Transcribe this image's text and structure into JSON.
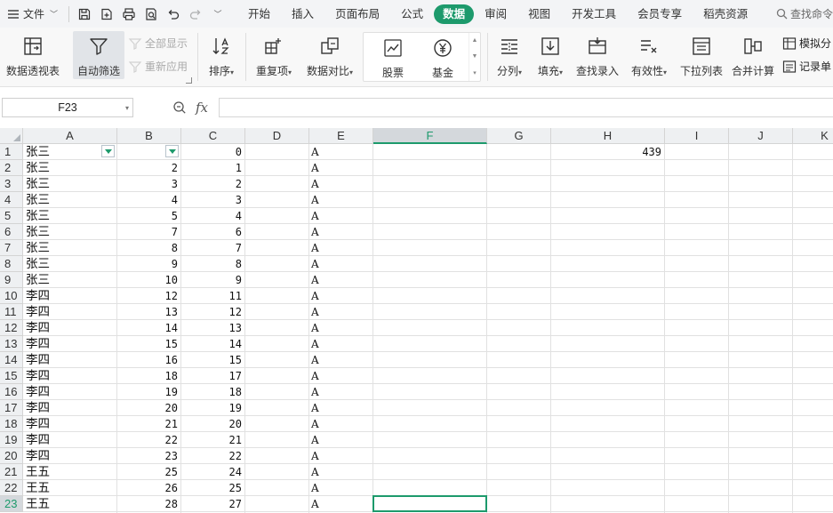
{
  "menubar": {
    "file_label": "文件",
    "tabs": [
      "开始",
      "插入",
      "页面布局",
      "公式",
      "数据",
      "审阅",
      "视图",
      "开发工具",
      "会员专享",
      "稻壳资源"
    ],
    "active_tab": "数据",
    "search_label": "查找命令",
    "accent_color": "#1d9a6c"
  },
  "ribbon": {
    "pivot_label": "数据透视表",
    "autofilter_label": "自动筛选",
    "show_all_label": "全部显示",
    "reapply_label": "重新应用",
    "sort_label": "排序",
    "duplicates_label": "重复项",
    "compare_label": "数据对比",
    "stock_label": "股票",
    "fund_label": "基金",
    "split_label": "分列",
    "fill_label": "填充",
    "lookup_label": "查找录入",
    "validity_label": "有效性",
    "dropdown_list_label": "下拉列表",
    "consolidate_label": "合并计算",
    "simulate_label": "模拟分",
    "record_label": "记录单"
  },
  "formula_bar": {
    "name_box": "F23",
    "fx_label": "fx",
    "formula": ""
  },
  "sheet": {
    "columns": [
      "A",
      "B",
      "C",
      "D",
      "E",
      "F",
      "G",
      "H",
      "I",
      "J",
      "K"
    ],
    "selected_column": "F",
    "selected_row": 23,
    "active_cell": "F23",
    "rows": [
      {
        "n": "1",
        "a": "张三",
        "b": "",
        "c": "0",
        "e": "A",
        "h": "439"
      },
      {
        "n": "2",
        "a": "张三",
        "b": "2",
        "c": "1",
        "e": "A",
        "h": ""
      },
      {
        "n": "3",
        "a": "张三",
        "b": "3",
        "c": "2",
        "e": "A",
        "h": ""
      },
      {
        "n": "4",
        "a": "张三",
        "b": "4",
        "c": "3",
        "e": "A",
        "h": ""
      },
      {
        "n": "5",
        "a": "张三",
        "b": "5",
        "c": "4",
        "e": "A",
        "h": ""
      },
      {
        "n": "6",
        "a": "张三",
        "b": "7",
        "c": "6",
        "e": "A",
        "h": ""
      },
      {
        "n": "7",
        "a": "张三",
        "b": "8",
        "c": "7",
        "e": "A",
        "h": ""
      },
      {
        "n": "8",
        "a": "张三",
        "b": "9",
        "c": "8",
        "e": "A",
        "h": ""
      },
      {
        "n": "9",
        "a": "张三",
        "b": "10",
        "c": "9",
        "e": "A",
        "h": ""
      },
      {
        "n": "10",
        "a": "李四",
        "b": "12",
        "c": "11",
        "e": "A",
        "h": ""
      },
      {
        "n": "11",
        "a": "李四",
        "b": "13",
        "c": "12",
        "e": "A",
        "h": ""
      },
      {
        "n": "12",
        "a": "李四",
        "b": "14",
        "c": "13",
        "e": "A",
        "h": ""
      },
      {
        "n": "13",
        "a": "李四",
        "b": "15",
        "c": "14",
        "e": "A",
        "h": ""
      },
      {
        "n": "14",
        "a": "李四",
        "b": "16",
        "c": "15",
        "e": "A",
        "h": ""
      },
      {
        "n": "15",
        "a": "李四",
        "b": "18",
        "c": "17",
        "e": "A",
        "h": ""
      },
      {
        "n": "16",
        "a": "李四",
        "b": "19",
        "c": "18",
        "e": "A",
        "h": ""
      },
      {
        "n": "17",
        "a": "李四",
        "b": "20",
        "c": "19",
        "e": "A",
        "h": ""
      },
      {
        "n": "18",
        "a": "李四",
        "b": "21",
        "c": "20",
        "e": "A",
        "h": ""
      },
      {
        "n": "19",
        "a": "李四",
        "b": "22",
        "c": "21",
        "e": "A",
        "h": ""
      },
      {
        "n": "20",
        "a": "李四",
        "b": "23",
        "c": "22",
        "e": "A",
        "h": ""
      },
      {
        "n": "21",
        "a": "王五",
        "b": "25",
        "c": "24",
        "e": "A",
        "h": ""
      },
      {
        "n": "22",
        "a": "王五",
        "b": "26",
        "c": "25",
        "e": "A",
        "h": ""
      },
      {
        "n": "23",
        "a": "王五",
        "b": "28",
        "c": "27",
        "e": "A",
        "h": ""
      }
    ]
  }
}
